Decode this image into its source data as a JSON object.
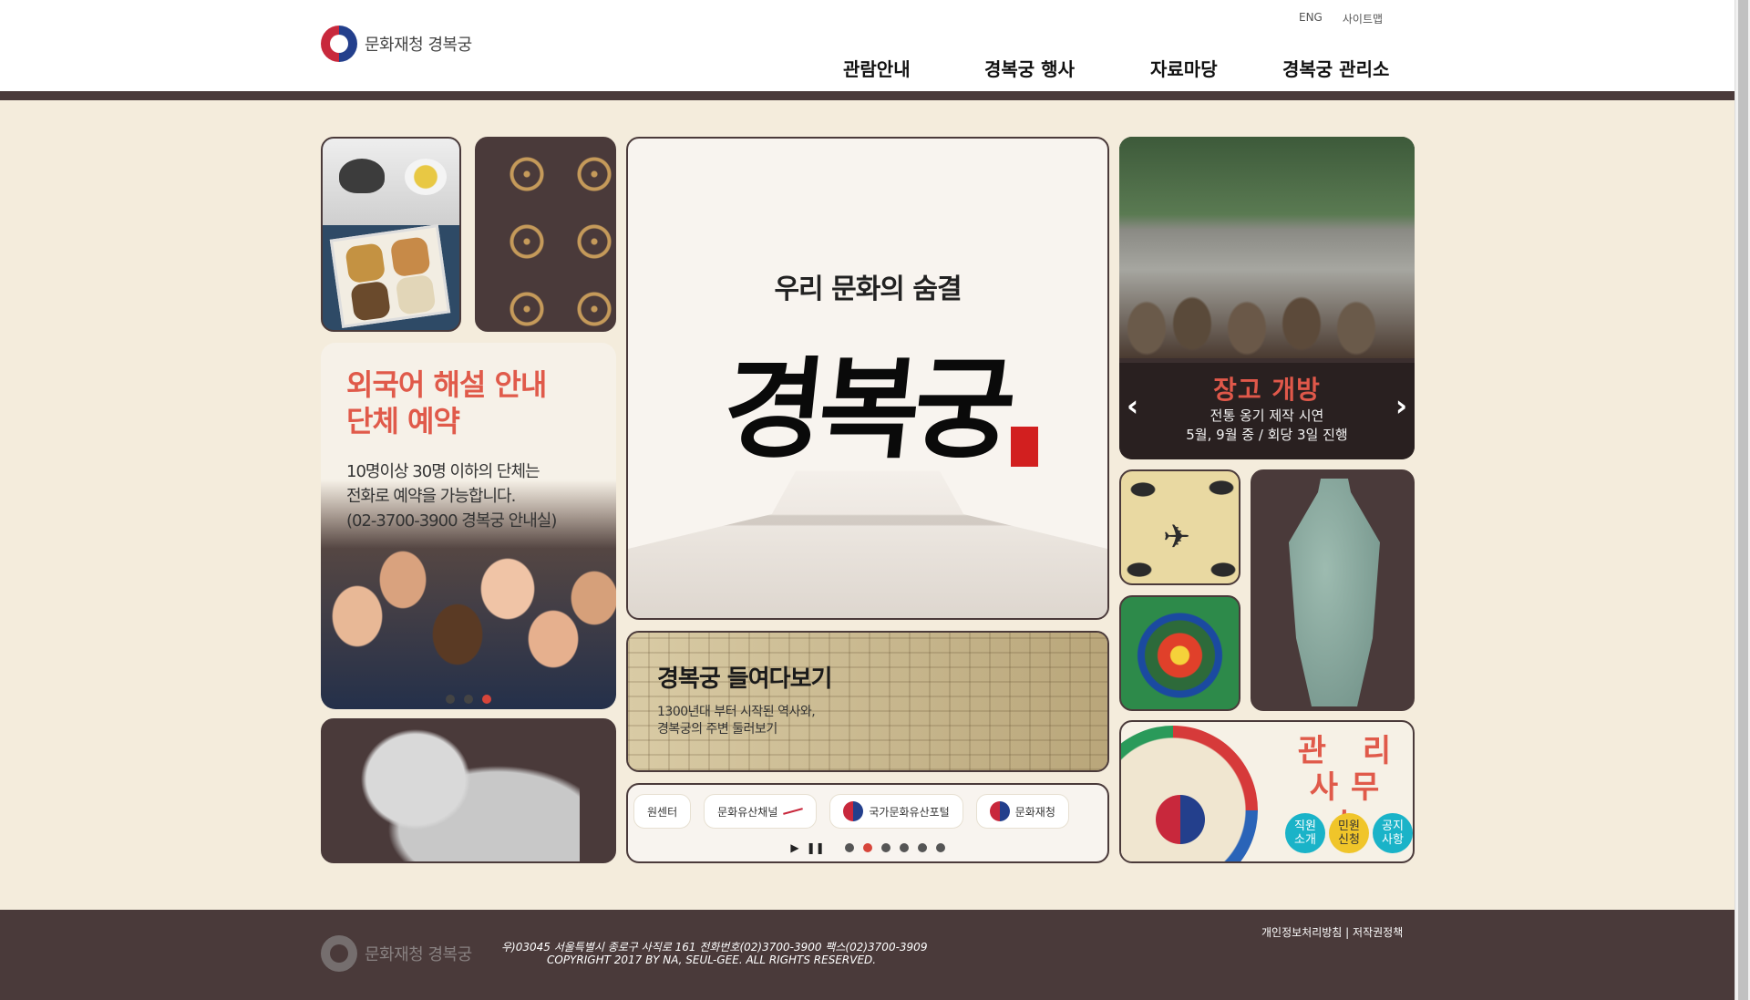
{
  "header": {
    "logo_text": "문화재청 경복궁",
    "util": {
      "eng": "ENG",
      "sitemap": "사이트맵"
    },
    "nav": [
      "관람안내",
      "경복궁 행사",
      "자료마당",
      "경복궁 관리소"
    ]
  },
  "guide": {
    "title_line1": "외국어 해설 안내",
    "title_line2": "단체 예약",
    "desc_line1": "10명이상 30명 이하의 단체는",
    "desc_line2": "전화로 예약을 가능합니다.",
    "desc_line3": "(02-3700-3900 경복궁 안내실)",
    "slide_count": 3,
    "active_slide": 3
  },
  "main": {
    "subtitle": "우리 문화의 숨결",
    "title": "경복궁",
    "seal": "경복궁"
  },
  "peek": {
    "title": "경복궁 들여다보기",
    "desc_line1": "1300년대 부터 시작된 역사와,",
    "desc_line2": "경복궁의 주변 둘러보기"
  },
  "links": {
    "cards": [
      "원센터",
      "문화유산채널",
      "국가문화유산포털",
      "문화재청"
    ],
    "play": "▶",
    "pause": "❚❚",
    "dot_count": 6,
    "active_dot": 2
  },
  "event": {
    "title": "장고 개방",
    "desc_line1": "전통 옹기 제작 시연",
    "desc_line2": "5월, 9월 중 / 회당 3일 진행",
    "prev": "‹",
    "next": "›"
  },
  "office": {
    "title_line1": "관 리",
    "title_line2": "사무소",
    "btn1": [
      "직원",
      "소개"
    ],
    "btn2": [
      "민원",
      "신청"
    ],
    "btn3": [
      "공지",
      "사항"
    ]
  },
  "footer": {
    "logo_text": "문화재청 경복궁",
    "address": "우)03045 서울특별시 종로구 사직로 161 전화번호(02)3700-3900 팩스(02)3700-3909",
    "copyright": "COPYRIGHT 2017 BY NA, SEUL-GEE. ALL RIGHTS RESERVED.",
    "privacy": "개인정보처리방침",
    "separator": "|",
    "copyright_policy": "저작권정책"
  },
  "colors": {
    "accent": "#e05a4a",
    "dark": "#4a3a3a",
    "background": "#f4ecdc"
  }
}
